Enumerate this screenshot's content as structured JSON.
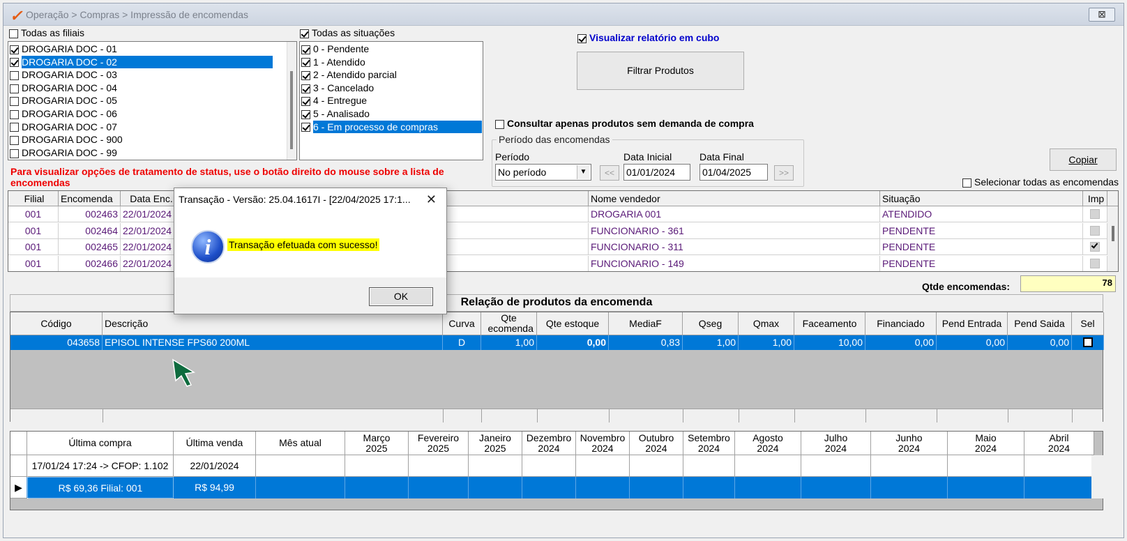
{
  "window": {
    "title": "Operação > Compras > Impressão de encomendas",
    "close_label": "⊠"
  },
  "filiais": {
    "all_label": "Todas as filiais",
    "items": [
      {
        "label": "DROGARIA DOC - 01",
        "checked": true
      },
      {
        "label": "DROGARIA DOC - 02",
        "checked": true,
        "selected": true
      },
      {
        "label": "DROGARIA DOC - 03",
        "checked": false
      },
      {
        "label": "DROGARIA DOC - 04",
        "checked": false
      },
      {
        "label": "DROGARIA DOC - 05",
        "checked": false
      },
      {
        "label": "DROGARIA DOC - 06",
        "checked": false
      },
      {
        "label": "DROGARIA DOC - 07",
        "checked": false
      },
      {
        "label": "DROGARIA DOC - 900",
        "checked": false
      },
      {
        "label": "DROGARIA DOC - 99",
        "checked": false
      }
    ]
  },
  "situacoes": {
    "all_label": "Todas as situações",
    "items": [
      {
        "label": "0 - Pendente",
        "checked": true
      },
      {
        "label": "1 - Atendido",
        "checked": true
      },
      {
        "label": "2 - Atendido parcial",
        "checked": true
      },
      {
        "label": "3 - Cancelado",
        "checked": true
      },
      {
        "label": "4 - Entregue",
        "checked": true
      },
      {
        "label": "5 - Analisado",
        "checked": true
      },
      {
        "label": "6 - Em processo de compras",
        "checked": true,
        "selected": true
      }
    ]
  },
  "cubo_label": "Visualizar relatório em cubo",
  "filtrar_label": "Filtrar Produtos",
  "sem_demanda_label": "Consultar apenas produtos sem demanda de compra",
  "periodo": {
    "group_label": "Período das encomendas",
    "periodo_label": "Período",
    "periodo_value": "No período",
    "data_inicial_label": "Data Inicial",
    "data_inicial": "01/01/2024",
    "data_final_label": "Data Final",
    "data_final": "01/04/2025",
    "prev": "<<",
    "next": ">>"
  },
  "copiar_label": "Copiar",
  "selecionar_todas_label": "Selecionar todas as encomendas",
  "status_hint": "Para visualizar opções de tratamento de status, use o botão direito do mouse sobre a lista de encomendas",
  "orders": {
    "headers": {
      "filial": "Filial",
      "encomenda": "Encomenda",
      "data": "Data Enc.",
      "vendedor": "Nome vendedor",
      "situacao": "Situação",
      "imp": "Imp"
    },
    "rows": [
      {
        "filial": "001",
        "encomenda": "002463",
        "data": "22/01/2024",
        "vendedor": "DROGARIA 001",
        "situacao": "ATENDIDO",
        "imp": false
      },
      {
        "filial": "001",
        "encomenda": "002464",
        "data": "22/01/2024",
        "vendedor": "FUNCIONARIO - 361",
        "situacao": "PENDENTE",
        "imp": false
      },
      {
        "filial": "001",
        "encomenda": "002465",
        "data": "22/01/2024",
        "vendedor": "FUNCIONARIO - 311",
        "situacao": "PENDENTE",
        "imp": true
      },
      {
        "filial": "001",
        "encomenda": "002466",
        "data": "22/01/2024",
        "vendedor": "FUNCIONARIO - 149",
        "situacao": "PENDENTE",
        "imp": false
      }
    ]
  },
  "qtde_label": "Qtde encomendas:",
  "qtde_value": "78",
  "produtos": {
    "title": "Relação de produtos da encomenda",
    "headers": {
      "codigo": "Código",
      "descricao": "Descrição",
      "curva": "Curva",
      "qte_enc": "Qte ecomenda",
      "qte_estoque": "Qte estoque",
      "mediaf": "MediaF",
      "qseg": "Qseg",
      "qmax": "Qmax",
      "faceamento": "Faceamento",
      "financiado": "Financiado",
      "pend_entrada": "Pend Entrada",
      "pend_saida": "Pend Saida",
      "sel": "Sel"
    },
    "row": {
      "codigo": "043658",
      "descricao": "EPISOL INTENSE FPS60 200ML",
      "curva": "D",
      "qte_enc": "1,00",
      "qte_estoque": "0,00",
      "mediaf": "0,83",
      "qseg": "1,00",
      "qmax": "1,00",
      "faceamento": "10,00",
      "financiado": "0,00",
      "pend_entrada": "0,00",
      "pend_saida": "0,00"
    }
  },
  "historico": {
    "headers": {
      "ultima_compra": "Última compra",
      "ultima_venda": "Última venda",
      "mes_atual": "Mês atual",
      "months": [
        {
          "m": "Março",
          "y": "2025"
        },
        {
          "m": "Fevereiro",
          "y": "2025"
        },
        {
          "m": "Janeiro",
          "y": "2025"
        },
        {
          "m": "Dezembro",
          "y": "2024"
        },
        {
          "m": "Novembro",
          "y": "2024"
        },
        {
          "m": "Outubro",
          "y": "2024"
        },
        {
          "m": "Setembro",
          "y": "2024"
        },
        {
          "m": "Agosto",
          "y": "2024"
        },
        {
          "m": "Julho",
          "y": "2024"
        },
        {
          "m": "Junho",
          "y": "2024"
        },
        {
          "m": "Maio",
          "y": "2024"
        },
        {
          "m": "Abril",
          "y": "2024"
        }
      ]
    },
    "row1": {
      "ultima_compra": "17/01/24 17:24 -> CFOP: 1.102",
      "ultima_venda": "22/01/2024"
    },
    "row2": {
      "ultima_compra": "R$ 69,36 Filial: 001",
      "ultima_venda": "R$ 94,99"
    }
  },
  "dialog": {
    "title": "Transação - Versão: 25.04.1617I - [22/04/2025 17:1...",
    "close": "✕",
    "message": "Transação efetuada com sucesso!",
    "ok": "OK"
  },
  "colors": {
    "selection": "#0078d7",
    "hint_red": "#e00000",
    "link_blue": "#0000cc",
    "qtde_bg": "#ffffc0"
  }
}
